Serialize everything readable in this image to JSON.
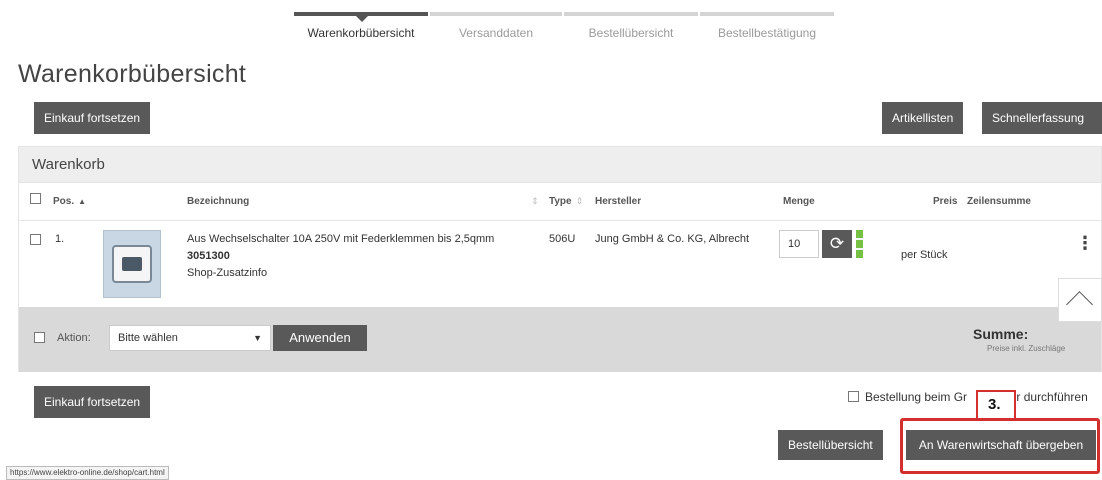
{
  "steps": [
    {
      "label": "Warenkorbübersicht",
      "active": true
    },
    {
      "label": "Versanddaten",
      "active": false
    },
    {
      "label": "Bestellübersicht",
      "active": false
    },
    {
      "label": "Bestellbestätigung",
      "active": false
    }
  ],
  "page_title": "Warenkorbübersicht",
  "buttons": {
    "continue_shopping": "Einkauf fortsetzen",
    "article_lists": "Artikellisten",
    "quick_entry": "Schnellerfassung",
    "order_overview": "Bestellübersicht",
    "transfer": "An Warenwirtschaft übergeben"
  },
  "cart": {
    "title": "Warenkorb",
    "columns": {
      "pos": "Pos.",
      "designation": "Bezeichnung",
      "type": "Type",
      "manufacturer": "Hersteller",
      "quantity": "Menge",
      "price": "Preis",
      "line_total": "Zeilensumme"
    },
    "items": [
      {
        "pos": "1.",
        "designation": "Aus Wechselschalter 10A 250V mit Federklemmen bis 2,5qmm",
        "article_no": "3051300",
        "extra": "Shop-Zusatzinfo",
        "type": "506U",
        "manufacturer": "Jung GmbH & Co. KG, Albrecht",
        "quantity": "10",
        "price_unit": "per Stück"
      }
    ],
    "action": {
      "label": "Aktion:",
      "select_value": "Bitte wählen",
      "apply": "Anwenden"
    },
    "sum_label": "Summe:",
    "sum_note": "Preise inkl. Zuschläge"
  },
  "order_checkbox_label": "Bestellung beim Gr",
  "order_checkbox_label_tail": "ler durchführen",
  "callout": "3.",
  "status_url": "https://www.elektro-online.de/shop/cart.html",
  "colors": {
    "button": "#595959",
    "availability": "#76c043",
    "highlight": "#d32f2f"
  }
}
